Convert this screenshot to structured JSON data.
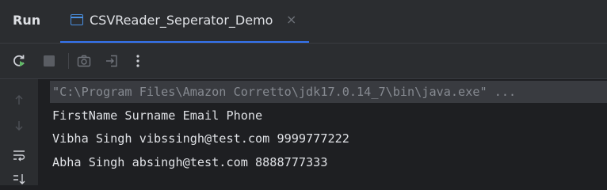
{
  "panel": {
    "title": "Run"
  },
  "tab": {
    "label": "CSVReader_Seperator_Demo",
    "close_glyph": "×"
  },
  "toolbar": {
    "buttons": [
      {
        "icon": "rerun-icon"
      },
      {
        "icon": "stop-icon"
      },
      {
        "icon": "camera-icon"
      },
      {
        "icon": "exit-icon"
      },
      {
        "icon": "more-options-icon"
      }
    ]
  },
  "gutter": {
    "buttons": [
      {
        "icon": "arrow-up-icon"
      },
      {
        "icon": "arrow-down-icon"
      },
      {
        "icon": "soft-wrap-icon"
      },
      {
        "icon": "sort-icon"
      }
    ]
  },
  "console": {
    "lines": [
      "\"C:\\Program Files\\Amazon Corretto\\jdk17.0.14_7\\bin\\java.exe\" ...",
      "FirstName Surname Email Phone",
      "Vibha Singh vibssingh@test.com 9999777222",
      "Abha Singh absingh@test.com 8888777333"
    ]
  },
  "colors": {
    "background": "#1e1f22",
    "panel": "#2b2d30",
    "accent": "#3574f0",
    "text": "#dfe1e5",
    "muted": "#868a91"
  }
}
